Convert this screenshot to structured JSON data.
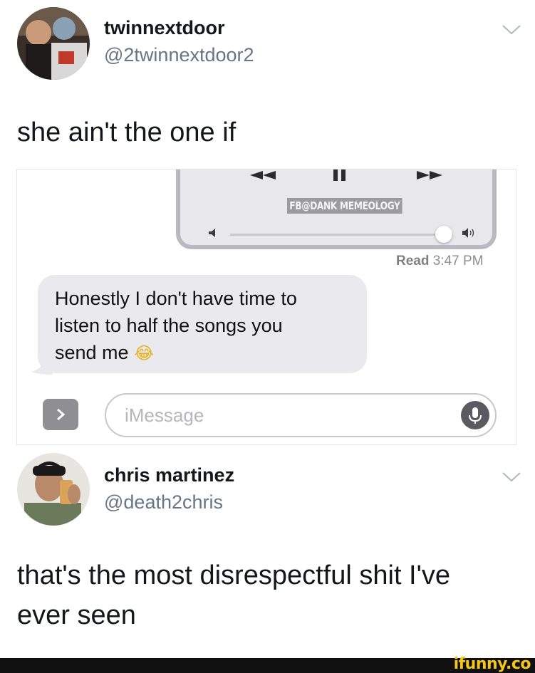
{
  "tweet1": {
    "display_name": "twinnextdoor",
    "handle": "@2twinnextdoor2",
    "text": "she ain't the one if"
  },
  "embedded_screenshot": {
    "watermark": "FB@DANK MEMEOLOGY",
    "read_label": "Read",
    "read_time": "3:47 PM",
    "message_lines": [
      "Honestly I don't have time to",
      "listen to half the songs you",
      "send me"
    ],
    "message_emoji": "😂",
    "input_placeholder": "iMessage",
    "progress_fraction": 1.0
  },
  "tweet2": {
    "display_name": "chris martinez",
    "handle": "@death2chris",
    "text_lines": [
      "that's the most disrespectful shit I've",
      "ever seen"
    ]
  },
  "footer": {
    "logo": "ifunny.co"
  },
  "colors": {
    "handle": "#657786",
    "bubble": "#e9e9ee",
    "player_bg": "#e7e7ec",
    "logo_yellow": "#f5c518"
  }
}
